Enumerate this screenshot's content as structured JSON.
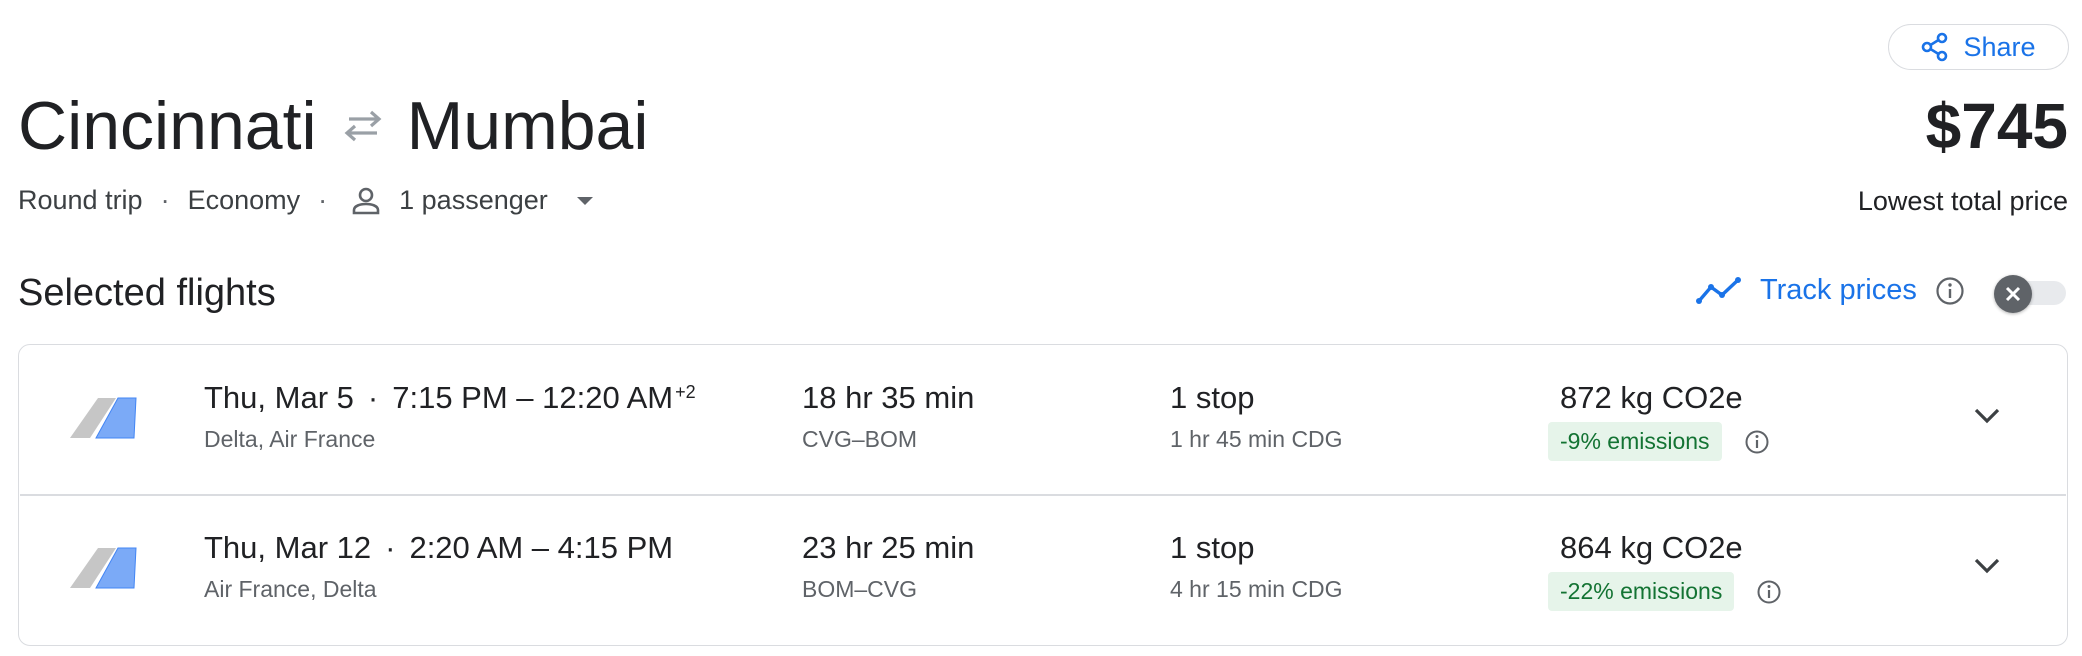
{
  "header": {
    "share_label": "Share",
    "origin": "Cincinnati",
    "destination": "Mumbai",
    "price": "$745",
    "price_caption": "Lowest total price"
  },
  "trip": {
    "type": "Round trip",
    "cabin": "Economy",
    "passengers": "1 passenger"
  },
  "section": {
    "title": "Selected flights",
    "track_label": "Track prices",
    "track_enabled": false
  },
  "flights": [
    {
      "date": "Thu, Mar 5",
      "times": "7:15 PM – 12:20 AM",
      "day_offset": "+2",
      "airlines": "Delta, Air France",
      "duration": "18 hr 35 min",
      "route": "CVG–BOM",
      "stops": "1 stop",
      "layover": "1 hr 45 min CDG",
      "co2": "872 kg CO2e",
      "emissions": "-9% emissions"
    },
    {
      "date": "Thu, Mar 12",
      "times": "2:20 AM – 4:15 PM",
      "day_offset": "",
      "airlines": "Air France, Delta",
      "duration": "23 hr 25 min",
      "route": "BOM–CVG",
      "stops": "1 stop",
      "layover": "4 hr 15 min CDG",
      "co2": "864 kg CO2e",
      "emissions": "-22% emissions"
    }
  ],
  "colors": {
    "accent": "#1a73e8",
    "emissions_bg": "#e6f4ea",
    "emissions_text": "#137333"
  },
  "icons": [
    "share-icon",
    "swap-arrows-icon",
    "person-icon",
    "caret-down-icon",
    "trend-icon",
    "info-icon",
    "close-icon",
    "airline-logo-icon",
    "chevron-down-icon"
  ]
}
